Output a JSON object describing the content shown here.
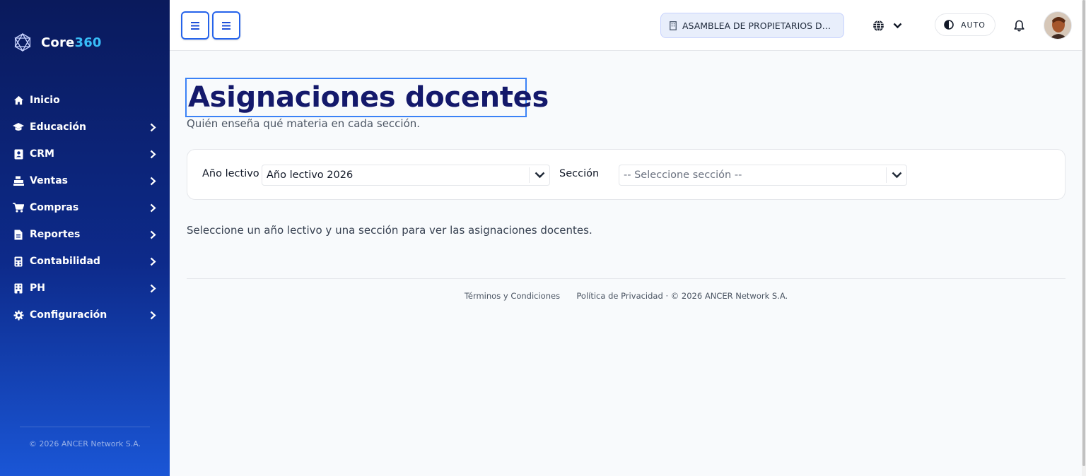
{
  "brand": {
    "name_primary": "Core",
    "name_accent": "360"
  },
  "sidebar": {
    "items": [
      {
        "label": "Inicio",
        "icon": "home-icon",
        "has_submenu": false
      },
      {
        "label": "Educación",
        "icon": "graduation-cap-icon",
        "has_submenu": true
      },
      {
        "label": "CRM",
        "icon": "address-book-icon",
        "has_submenu": true
      },
      {
        "label": "Ventas",
        "icon": "cash-register-icon",
        "has_submenu": true
      },
      {
        "label": "Compras",
        "icon": "cart-icon",
        "has_submenu": true
      },
      {
        "label": "Reportes",
        "icon": "file-icon",
        "has_submenu": true
      },
      {
        "label": "Contabilidad",
        "icon": "calculator-icon",
        "has_submenu": true
      },
      {
        "label": "PH",
        "icon": "building-icon",
        "has_submenu": true
      },
      {
        "label": "Configuración",
        "icon": "gear-icon",
        "has_submenu": true
      }
    ],
    "copyright": "© 2026 ANCER Network S.A."
  },
  "topbar": {
    "organization": "ASAMBLEA DE PROPIETARIOS DE ...",
    "theme_label": "AUTO"
  },
  "page": {
    "title": "Asignaciones docentes",
    "subtitle": "Quién enseña qué materia en cada sección.",
    "filters": {
      "year_label": "Año lectivo",
      "year_value": "Año lectivo 2026",
      "section_label": "Sección",
      "section_placeholder": "-- Seleccione sección --"
    },
    "empty_message": "Seleccione un año lectivo y una sección para ver las asignaciones docentes."
  },
  "footer": {
    "terms": "Términos y Condiciones",
    "privacy": "Política de Privacidad",
    "copyright": "· © 2026 ANCER Network S.A."
  },
  "colors": {
    "sidebar_top": "#0a1a5c",
    "sidebar_bottom": "#1a56d6",
    "accent": "#38bdf8",
    "title": "#14196b",
    "focus_border": "#2563eb"
  }
}
